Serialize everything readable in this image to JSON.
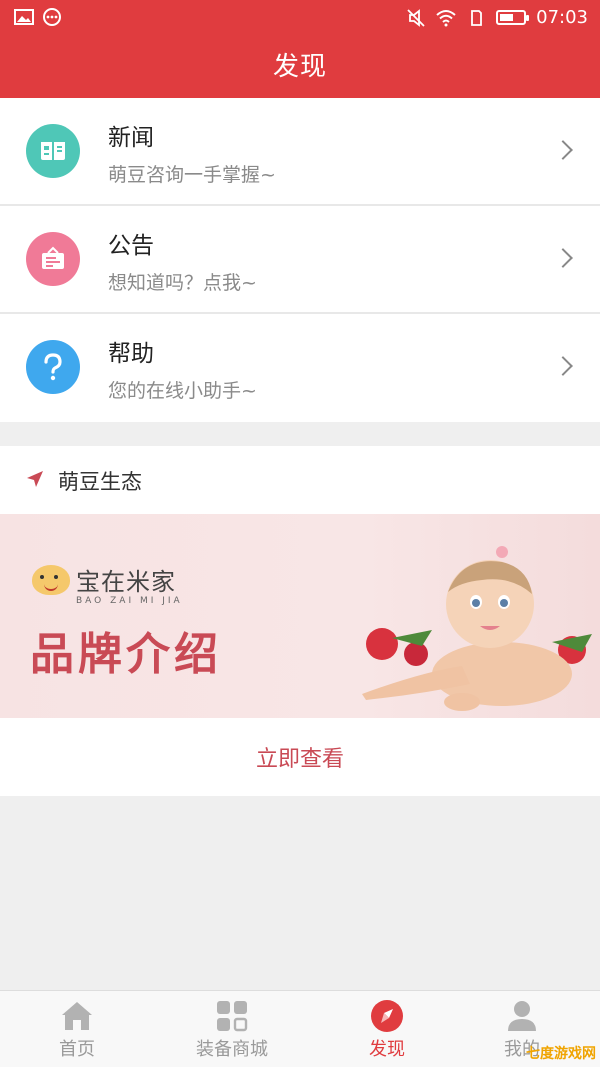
{
  "status_bar": {
    "time": "07:03"
  },
  "header": {
    "title": "发现"
  },
  "list": [
    {
      "title": "新闻",
      "subtitle": "萌豆咨询一手掌握~",
      "icon": "news-icon",
      "color": "#4fc7b7"
    },
    {
      "title": "公告",
      "subtitle": "想知道吗？点我~",
      "icon": "notice-icon",
      "color": "#f07a97"
    },
    {
      "title": "帮助",
      "subtitle": "您的在线小助手~",
      "icon": "help-icon",
      "color": "#3fa8ee"
    }
  ],
  "ecology": {
    "label": "萌豆生态"
  },
  "banner": {
    "brand_name": "宝在米家",
    "brand_sub": "BAO ZAI MI JIA",
    "intro": "品牌介绍"
  },
  "view_now": "立即查看",
  "tabs": [
    {
      "label": "首页",
      "icon": "home-icon",
      "active": false
    },
    {
      "label": "装备商城",
      "icon": "grid-icon",
      "active": false
    },
    {
      "label": "发现",
      "icon": "compass-icon",
      "active": true
    },
    {
      "label": "我的",
      "icon": "person-icon",
      "active": false
    }
  ],
  "watermark": "七度游戏网",
  "colors": {
    "brand_red": "#e03c3f",
    "accent_text": "#c94a55"
  }
}
